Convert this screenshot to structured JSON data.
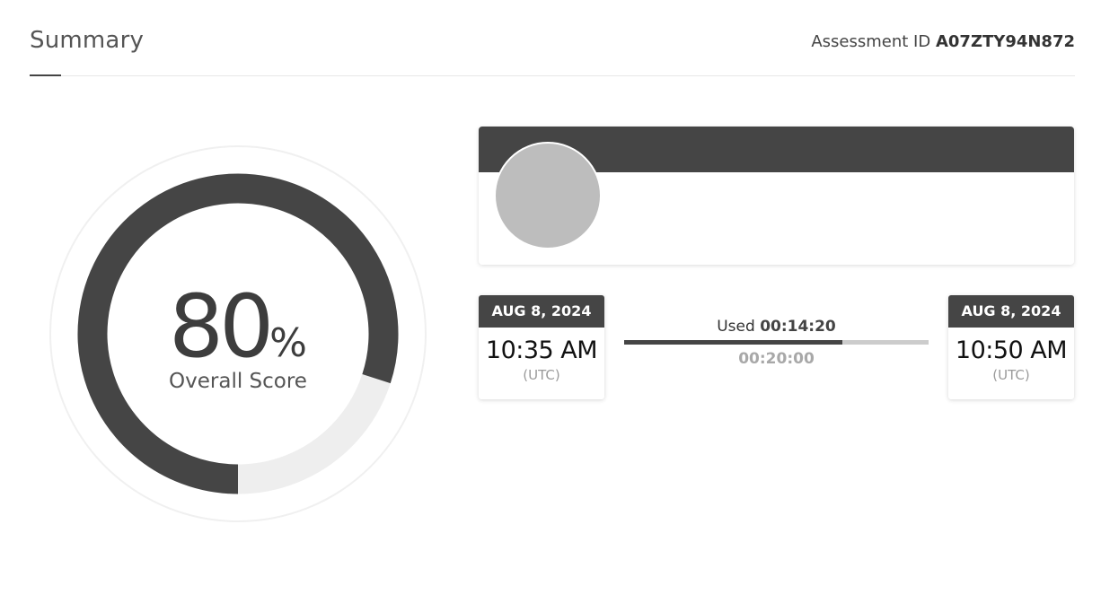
{
  "header": {
    "title": "Summary",
    "assessment_label": "Assessment ID",
    "assessment_id": "A07ZTY94N872"
  },
  "score": {
    "value": "80",
    "unit": "%",
    "label": "Overall Score",
    "fraction": 0.8
  },
  "profile": {},
  "timing": {
    "start": {
      "date": "AUG 8, 2024",
      "time": "10:35 AM",
      "zone": "(UTC)"
    },
    "end": {
      "date": "AUG 8, 2024",
      "time": "10:50 AM",
      "zone": "(UTC)"
    },
    "used_label": "Used",
    "used_value": "00:14:20",
    "total": "00:20:00",
    "used_fraction": 0.717
  },
  "colors": {
    "accent": "#454545",
    "track": "#eeeeee",
    "avatar": "#bdbdbd"
  }
}
